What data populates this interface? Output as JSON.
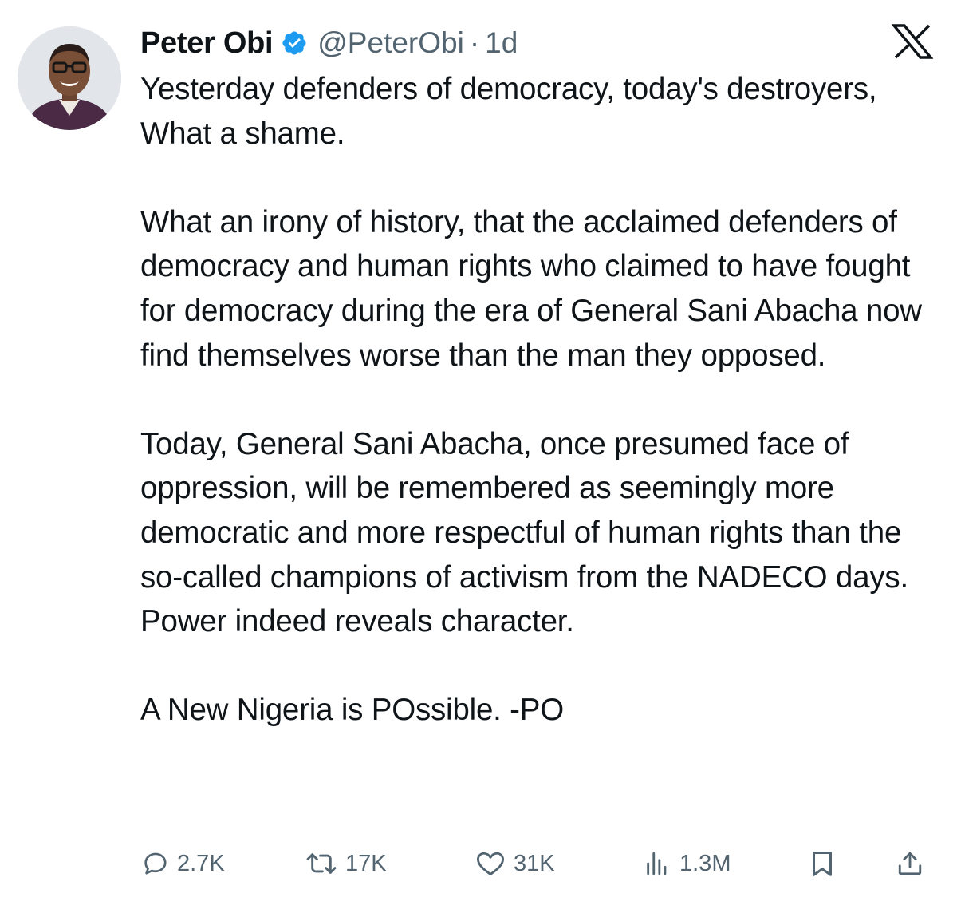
{
  "tweet": {
    "display_name": "Peter Obi",
    "handle": "@PeterObi",
    "separator": "·",
    "time": "1d",
    "paragraphs": [
      "Yesterday defenders of democracy, today's destroyers, What a shame.",
      "What an irony of history, that the acclaimed defenders of democracy and human rights who claimed to have fought for democracy during the era of General Sani Abacha now find themselves worse than the man they opposed.",
      "Today, General Sani Abacha, once presumed face of oppression, will be remembered as seemingly more democratic and more respectful of human rights than the so-called champions of activism from the NADECO days. Power indeed reveals character.",
      "A New Nigeria is POssible. -PO"
    ]
  },
  "actions": {
    "replies": "2.7K",
    "reposts": "17K",
    "likes": "31K",
    "views": "1.3M"
  },
  "icons": {
    "verified": "verified-badge-icon",
    "logo": "x-logo-icon",
    "reply": "reply-icon",
    "repost": "repost-icon",
    "like": "heart-icon",
    "views": "views-icon",
    "bookmark": "bookmark-icon",
    "share": "share-icon"
  },
  "colors": {
    "text": "#0f1419",
    "secondary": "#536471",
    "verified": "#1d9bf0"
  }
}
